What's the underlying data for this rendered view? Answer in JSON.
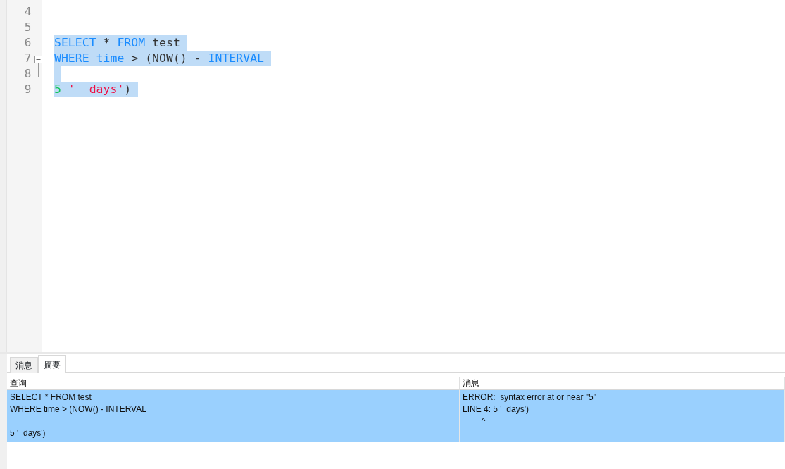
{
  "editor": {
    "lines": [
      {
        "number": "4",
        "selected": false,
        "kind": "plain"
      },
      {
        "number": "5",
        "selected": false,
        "kind": "plain"
      },
      {
        "number": "6",
        "selected": true,
        "kind": "plain",
        "tokens": [
          {
            "kind": "keyword",
            "text": "SELECT"
          },
          {
            "kind": "plain",
            "text": " * "
          },
          {
            "kind": "keyword",
            "text": "FROM"
          },
          {
            "kind": "plain",
            "text": " test"
          }
        ]
      },
      {
        "number": "7",
        "selected": true,
        "kind": "fold-start",
        "tokens": [
          {
            "kind": "keyword",
            "text": "WHERE"
          },
          {
            "kind": "keyword",
            "text": " time"
          },
          {
            "kind": "plain",
            "text": " > (NOW() - "
          },
          {
            "kind": "keyword",
            "text": "INTERVAL"
          }
        ]
      },
      {
        "number": "8",
        "selected": true,
        "kind": "fold-end"
      },
      {
        "number": "9",
        "selected": true,
        "kind": "plain",
        "tokens": [
          {
            "kind": "number",
            "text": "5"
          },
          {
            "kind": "string",
            "text": " '  days'"
          },
          {
            "kind": "plain",
            "text": ")"
          }
        ]
      }
    ]
  },
  "result_panel": {
    "tabs": [
      {
        "label": "消息",
        "selected": false
      },
      {
        "label": "摘要",
        "selected": true
      }
    ],
    "table": {
      "columns": [
        "查询",
        "消息"
      ],
      "rows": [
        {
          "selected": true,
          "cells": [
            "SELECT * FROM test\nWHERE time > (NOW() - INTERVAL\n\n5 '  days')",
            "ERROR:  syntax error at or near \"5\"\nLINE 4: 5 '  days')\n        ^"
          ]
        }
      ]
    }
  }
}
